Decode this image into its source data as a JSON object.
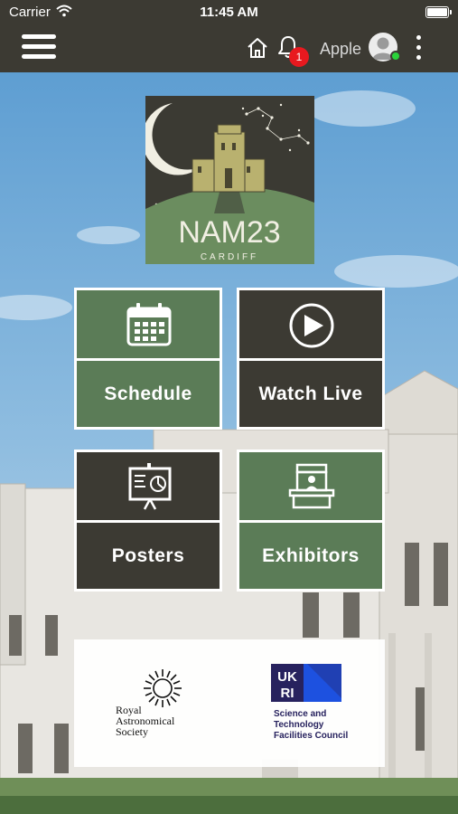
{
  "status_bar": {
    "carrier": "Carrier",
    "time": "11:45 AM"
  },
  "header": {
    "notification_count": "1",
    "user_name": "Apple"
  },
  "logo": {
    "title": "NAM23",
    "subtitle": "CARDIFF"
  },
  "tiles": [
    {
      "label": "Schedule",
      "icon": "calendar-icon"
    },
    {
      "label": "Watch Live",
      "icon": "play-icon"
    },
    {
      "label": "Posters",
      "icon": "presentation-board-icon"
    },
    {
      "label": "Exhibitors",
      "icon": "exhibitor-booth-icon"
    }
  ],
  "sponsors": {
    "ras": {
      "line1": "Royal",
      "line2": "Astronomical",
      "line3": "Society"
    },
    "ukri": {
      "logo_text": "UKRI",
      "line1": "Science and",
      "line2": "Technology",
      "line3": "Facilities Council"
    }
  },
  "colors": {
    "header_bg": "#3c3a33",
    "tile_green": "#5b7c57",
    "tile_dark": "#3c3a33",
    "badge_red": "#e8191f",
    "online_green": "#2bd23a"
  }
}
